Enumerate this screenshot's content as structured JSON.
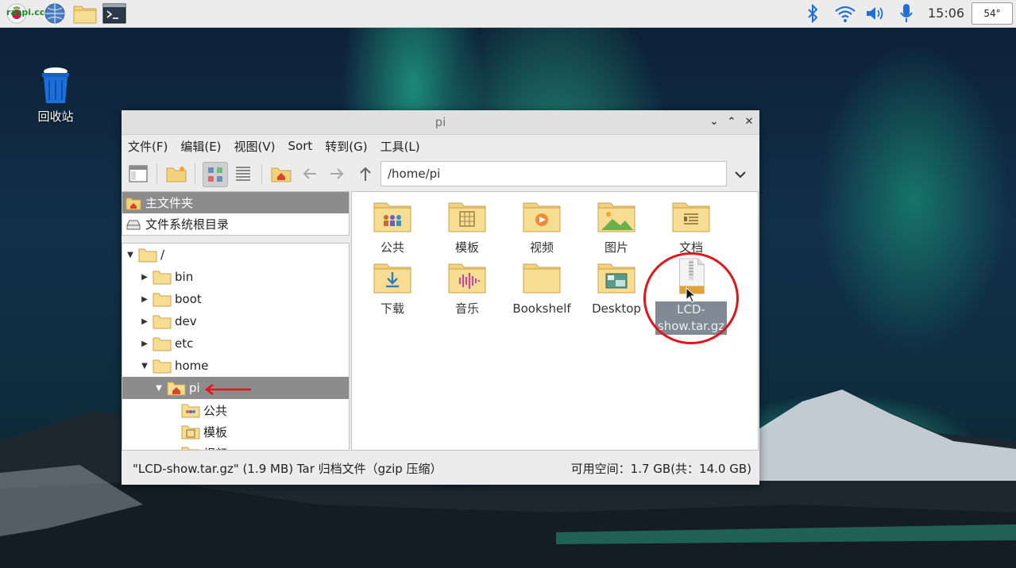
{
  "panel": {
    "apps": [
      "raspberry-menu-icon",
      "web-browser-icon",
      "file-manager-icon",
      "terminal-icon"
    ],
    "raspi_label": "raspi.cc",
    "clock": "15:06",
    "cpu_temp": "54°"
  },
  "desktop": {
    "trash_label": "回收站"
  },
  "window": {
    "title": "pi",
    "menu": [
      "文件(F)",
      "编辑(E)",
      "视图(V)",
      "Sort",
      "转到(G)",
      "工具(L)"
    ],
    "path": "/home/pi",
    "places": [
      {
        "label": "主文件夹",
        "icon": "home-folder-icon",
        "selected": true
      },
      {
        "label": "文件系统根目录",
        "icon": "drive-icon",
        "selected": false
      }
    ],
    "tree": [
      {
        "label": "/",
        "arrow": "▼",
        "icon": "folder-icon"
      },
      {
        "label": "bin",
        "arrow": "▶",
        "icon": "folder-icon"
      },
      {
        "label": "boot",
        "arrow": "▶",
        "icon": "folder-icon"
      },
      {
        "label": "dev",
        "arrow": "▶",
        "icon": "folder-icon"
      },
      {
        "label": "etc",
        "arrow": "▶",
        "icon": "folder-icon"
      },
      {
        "label": "home",
        "arrow": "▼",
        "icon": "folder-icon"
      },
      {
        "label": "pi",
        "arrow": "▼",
        "icon": "home-folder-icon",
        "selected": true
      },
      {
        "label": "公共",
        "arrow": "",
        "icon": "public-folder-icon"
      },
      {
        "label": "模板",
        "arrow": "",
        "icon": "templates-folder-icon"
      },
      {
        "label": "视频",
        "arrow": "",
        "icon": "videos-folder-icon"
      }
    ],
    "files": [
      {
        "label": "公共",
        "icon": "public-folder-icon"
      },
      {
        "label": "模板",
        "icon": "templates-folder-icon"
      },
      {
        "label": "视频",
        "icon": "videos-folder-icon"
      },
      {
        "label": "图片",
        "icon": "pictures-folder-icon"
      },
      {
        "label": "文档",
        "icon": "documents-folder-icon"
      },
      {
        "label": "下载",
        "icon": "downloads-folder-icon"
      },
      {
        "label": "音乐",
        "icon": "music-folder-icon"
      },
      {
        "label": "Bookshelf",
        "icon": "folder-icon"
      },
      {
        "label": "Desktop",
        "icon": "desktop-folder-icon"
      },
      {
        "label": "LCD-show.tar.gz",
        "label_line1": "LCD-",
        "label_line2": "show.tar.gz",
        "icon": "archive-file-icon",
        "selected": true
      }
    ],
    "status_left": "\"LCD-show.tar.gz\" (1.9 MB) Tar 归档文件（gzip 压缩）",
    "status_right": "可用空间：1.7 GB(共：14.0 GB)"
  },
  "colors": {
    "accent_folder": "#f6d88a",
    "selection_gray": "#8c8c8c",
    "annotation_red": "#e0161b"
  }
}
